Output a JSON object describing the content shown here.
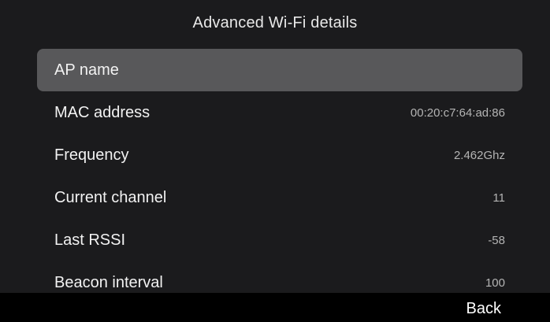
{
  "header": {
    "title": "Advanced Wi-Fi details"
  },
  "rows": [
    {
      "label": "AP name",
      "value": ""
    },
    {
      "label": "MAC address",
      "value": "00:20:c7:64:ad:86"
    },
    {
      "label": "Frequency",
      "value": "2.462Ghz"
    },
    {
      "label": "Current channel",
      "value": "11"
    },
    {
      "label": "Last RSSI",
      "value": "-58"
    },
    {
      "label": "Beacon interval",
      "value": "100"
    }
  ],
  "softkeys": {
    "back_label": "Back"
  },
  "colors": {
    "background": "#1b1b1d",
    "selected_row": "#58585a",
    "softkey_bar": "#000000"
  }
}
